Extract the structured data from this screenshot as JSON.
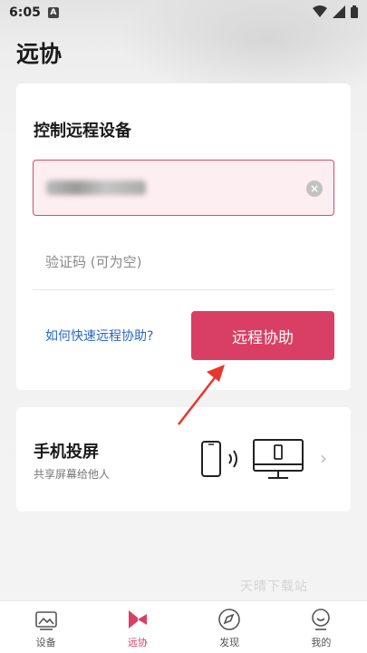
{
  "status": {
    "time": "6:05",
    "notif_badge": "A"
  },
  "page": {
    "title": "远协"
  },
  "remote_control": {
    "title": "控制远程设备",
    "device_id_value": "",
    "code_placeholder": "验证码 (可为空)",
    "help_link": "如何快速远程协助?",
    "assist_button": "远程协助"
  },
  "screen_cast": {
    "title": "手机投屏",
    "subtitle": "共享屏幕给他人"
  },
  "watermark": "天晴下载站",
  "bottom_nav": [
    {
      "label": "设备",
      "icon": "image-icon",
      "active": false
    },
    {
      "label": "远协",
      "icon": "bowtie-icon",
      "active": true
    },
    {
      "label": "发现",
      "icon": "compass-icon",
      "active": false
    },
    {
      "label": "我的",
      "icon": "smile-face-icon",
      "active": false
    }
  ],
  "colors": {
    "accent": "#d93f64",
    "link": "#2a66c8",
    "annotation_arrow": "#e8362c"
  }
}
